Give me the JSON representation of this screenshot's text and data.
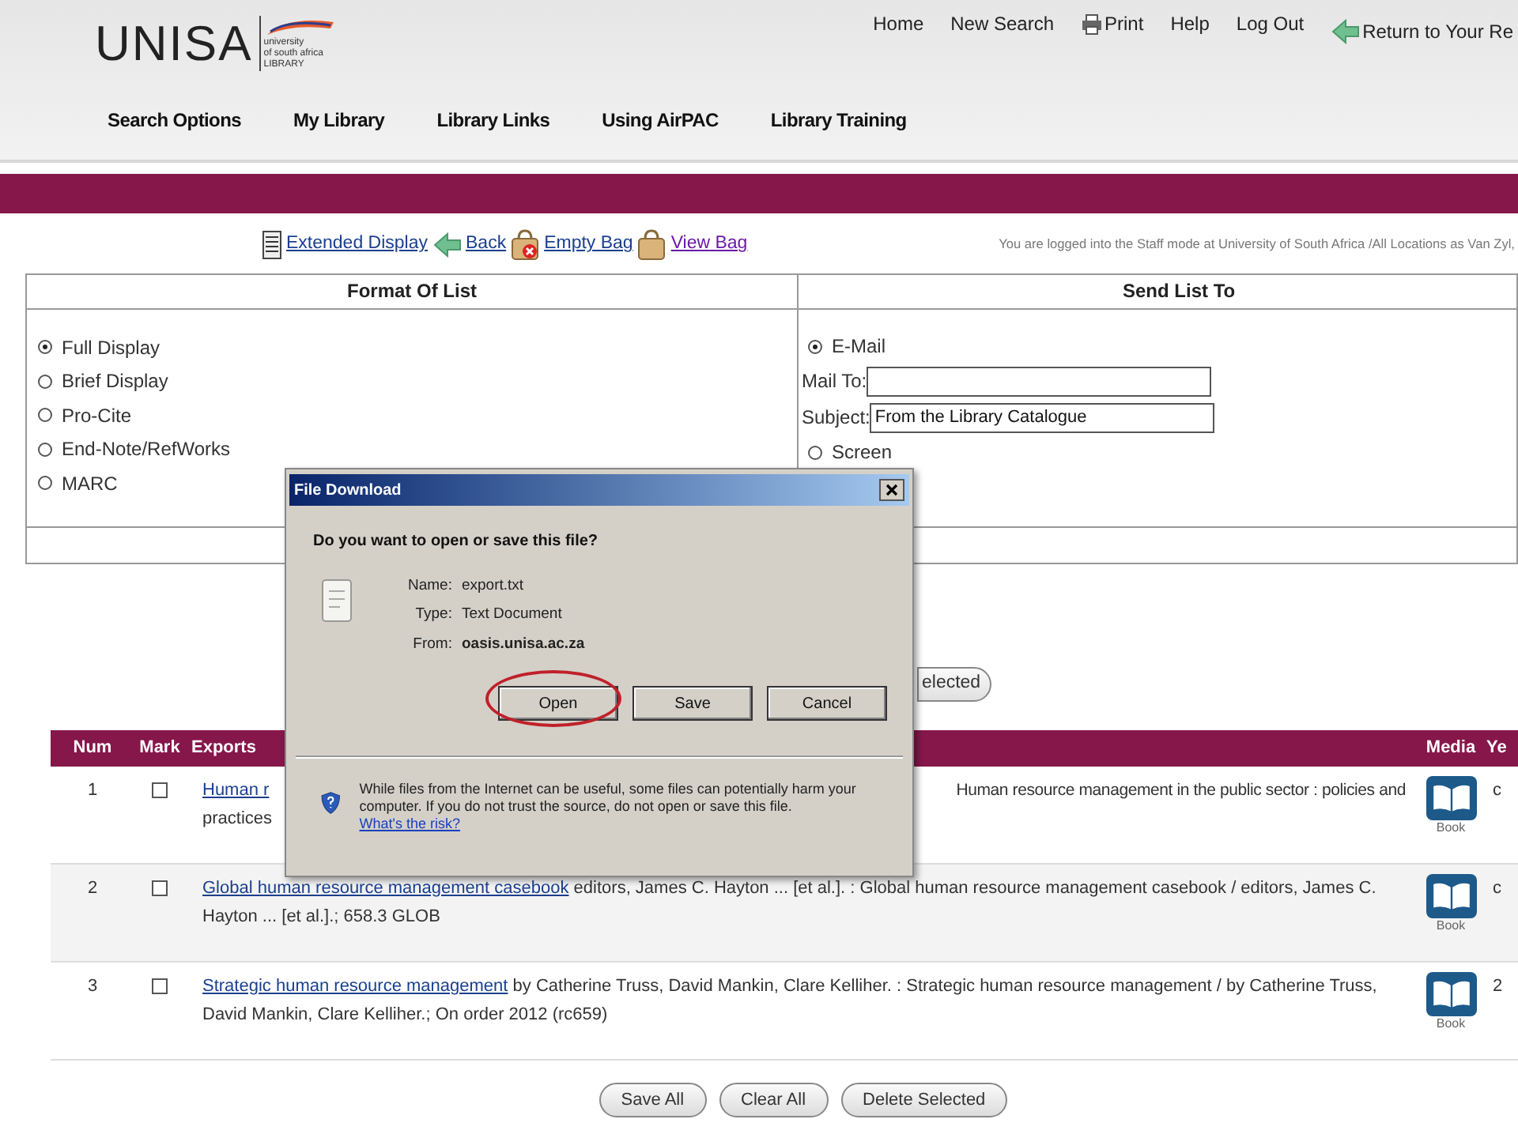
{
  "header": {
    "logo": {
      "wordmark": "UNISA",
      "subtitle": [
        "university",
        "of south africa",
        "LIBRARY"
      ]
    },
    "top_links": [
      {
        "label": "Home"
      },
      {
        "label": "New Search"
      },
      {
        "label": "Print"
      },
      {
        "label": "Help"
      },
      {
        "label": "Log Out"
      },
      {
        "label": "Return to Your Re"
      }
    ],
    "nav": [
      "Search Options",
      "My Library",
      "Library Links",
      "Using AirPAC",
      "Library Training"
    ]
  },
  "toolbar": {
    "links": [
      {
        "label": "Extended Display",
        "visited": false
      },
      {
        "label": "Back",
        "visited": false
      },
      {
        "label": "Empty Bag",
        "visited": false
      },
      {
        "label": "View Bag",
        "visited": true
      }
    ],
    "login_text": "You are logged into the Staff mode at University of South Africa /All Locations as Van Zyl,"
  },
  "export_form": {
    "format": {
      "heading": "Format Of List",
      "options": [
        {
          "label": "Full Display",
          "selected": true
        },
        {
          "label": "Brief Display",
          "selected": false
        },
        {
          "label": "Pro-Cite",
          "selected": false
        },
        {
          "label": "End-Note/RefWorks",
          "selected": false
        },
        {
          "label": "MARC",
          "selected": false
        }
      ]
    },
    "send": {
      "heading": "Send List To",
      "items": [
        {
          "kind": "radio",
          "label": "E-Mail",
          "selected": true
        },
        {
          "kind": "field",
          "label": "Mail To:"
        },
        {
          "kind": "field",
          "label": "Subject:",
          "value": "From the Library Catalogue"
        },
        {
          "kind": "radio",
          "label": "Screen",
          "selected": false
        }
      ]
    }
  },
  "partial_button": "elected",
  "results": {
    "columns": [
      "Num",
      "Mark",
      "Exports",
      "Media",
      "Ye"
    ],
    "rows": [
      {
        "num": "1",
        "marked": false,
        "title": "Human r",
        "right_text": "Human resource management in the public sector : policies and",
        "line2": "practices",
        "media": "Book",
        "column_5": "c"
      },
      {
        "num": "2",
        "marked": false,
        "title": "Global human resource management casebook",
        "text": "editors, James C. Hayton ... [et al.]. : Global human resource management casebook / editors, James C. Hayton ... [et al.].; 658.3 GLOB",
        "media": "Book",
        "column_5": "c"
      },
      {
        "num": "3",
        "marked": false,
        "title": "Strategic human resource management",
        "text": "by Catherine Truss, David Mankin, Clare Kelliher. : Strategic human resource management / by Catherine Truss, David Mankin, Clare Kelliher.; On order 2012 (rc659)",
        "media": "Book",
        "column_5": "2"
      }
    ],
    "buttons": [
      "Save All",
      "Clear All",
      "Delete Selected"
    ]
  },
  "dialog": {
    "title": "File Download",
    "question": "Do you want to open or save this file?",
    "details": [
      {
        "label": "Name:",
        "value": "export.txt",
        "bold": false
      },
      {
        "label": "Type:",
        "value": "Text Document",
        "bold": false
      },
      {
        "label": "From:",
        "value": "oasis.unisa.ac.za",
        "bold": true
      }
    ],
    "buttons": [
      {
        "label": "Open",
        "circled": true
      },
      {
        "label": "Save",
        "circled": false
      },
      {
        "label": "Cancel",
        "circled": false
      }
    ],
    "warning": "While files from the Internet can be useful, some files can potentially harm your computer. If you do not trust the source, do not open or save this file.",
    "risk_link": "What's the risk?"
  }
}
